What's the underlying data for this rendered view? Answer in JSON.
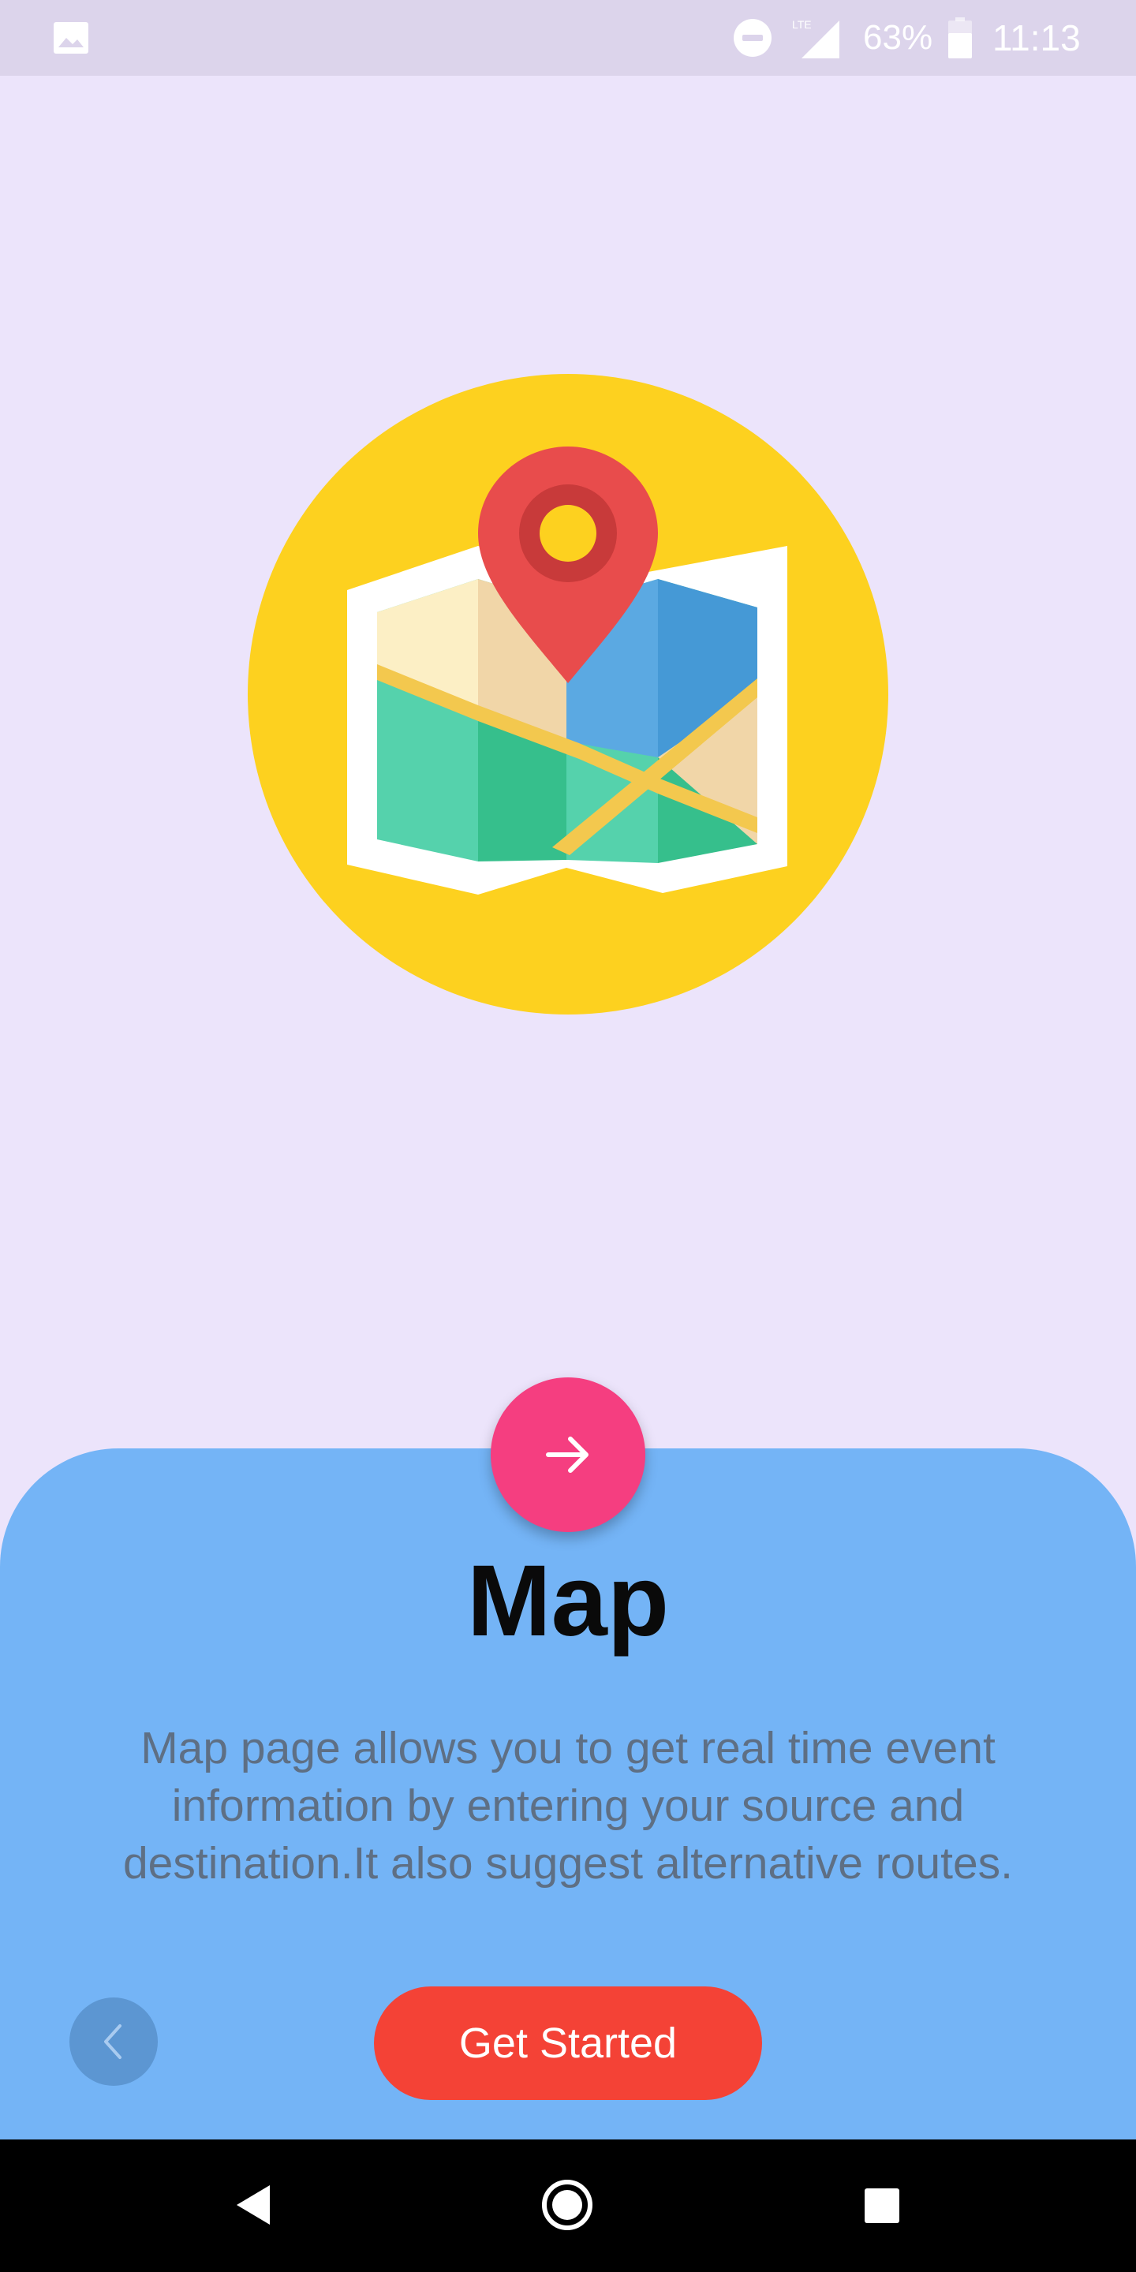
{
  "status_bar": {
    "battery_percent": "63%",
    "time": "11:13",
    "icons": [
      "image-notification-icon",
      "do-not-disturb-icon",
      "lte-signal-icon",
      "battery-icon"
    ]
  },
  "illustration": {
    "icon": "folded-map-with-location-pin-icon",
    "colors": {
      "circle": "#FDD11F",
      "pin": "#E84C4C",
      "pin_inner": "#C83A3A",
      "pin_center": "#FDD11F"
    }
  },
  "onboarding": {
    "next_icon": "arrow-right-icon",
    "title": "Map",
    "description_lines": [
      "Map page allows you to get real time event",
      "information by entering your source and",
      "destination.It also suggest alternative routes."
    ],
    "back_icon": "chevron-left-icon",
    "get_started_label": "Get Started"
  },
  "colors": {
    "background": "#ECE4FB",
    "panel": "#74B4F6",
    "fab": "#F53E80",
    "primary_button": "#F44236",
    "back_button": "#5C96D2"
  },
  "nav_bar": {
    "icons": [
      "nav-back-icon",
      "nav-home-icon",
      "nav-recents-icon"
    ]
  }
}
